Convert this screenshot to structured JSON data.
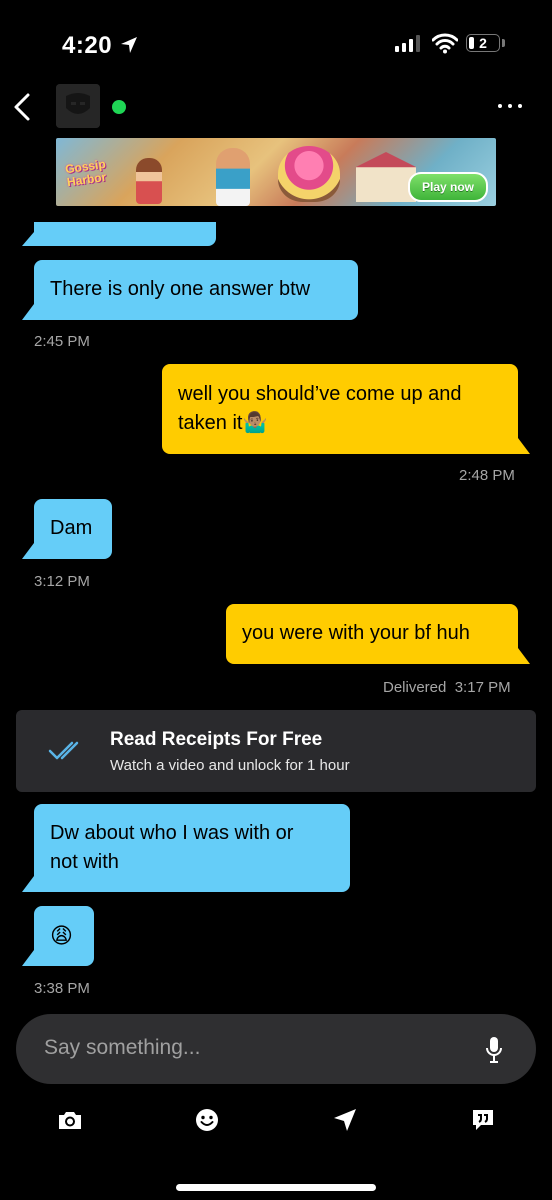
{
  "status_bar": {
    "time": "4:20",
    "battery": "2"
  },
  "header": {
    "online": true
  },
  "ad": {
    "brand": "Gossip Harbor",
    "cta": "Play now"
  },
  "messages": [
    {
      "dir": "in",
      "text": "There is only one answer btw",
      "time": "2:45 PM"
    },
    {
      "dir": "out",
      "text_line1": "well you should’ve come up and",
      "text_line2": "taken it🤷🏽‍♂️",
      "time": "2:48 PM"
    },
    {
      "dir": "in",
      "text": "Dam",
      "time": "3:12 PM"
    },
    {
      "dir": "out",
      "text": "you were with your bf huh",
      "status": "Delivered",
      "time": "3:17 PM"
    },
    {
      "dir": "in",
      "text_line1": "Dw about who I was with or",
      "text_line2": "not with"
    },
    {
      "dir": "in",
      "text": "😩",
      "time": "3:38 PM"
    }
  ],
  "read_receipts": {
    "title": "Read Receipts For Free",
    "subtitle": "Watch a video and unlock for 1 hour"
  },
  "composer": {
    "placeholder": "Say something..."
  },
  "toolbar": [
    "camera-icon",
    "emoji-icon",
    "location-icon",
    "saved-phrases-icon"
  ],
  "colors": {
    "incoming": "#65cdf8",
    "outgoing": "#ffcc00",
    "online": "#1fd655",
    "background": "#000000"
  }
}
